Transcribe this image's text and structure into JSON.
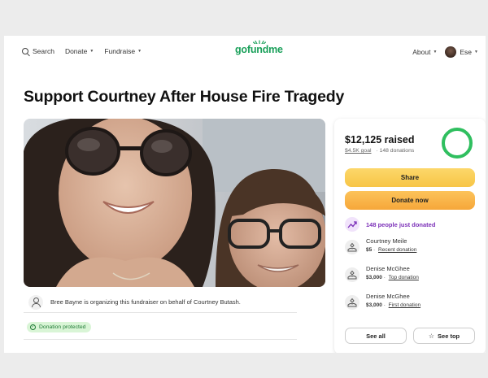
{
  "nav": {
    "search_label": "Search",
    "donate_label": "Donate",
    "fundraise_label": "Fundraise",
    "logo_text": "gofundme",
    "about_label": "About",
    "user_name": "Ese"
  },
  "campaign": {
    "title": "Support Courtney After House Fire Tragedy",
    "organizer_text": "Bree Bayne is organizing this fundraiser on behalf of Courtney Butash.",
    "protected_label": "Donation protected"
  },
  "donation": {
    "raised": "$12,125 raised",
    "goal": "$4.5K goal",
    "donations_count": "148 donations",
    "progress_fraction": 1.0,
    "share_label": "Share",
    "donate_now_label": "Donate now",
    "trend_text": "148 people just donated",
    "donors": [
      {
        "name": "Courtney Meile",
        "amount": "$5",
        "tag": "Recent donation"
      },
      {
        "name": "Denise McGhee",
        "amount": "$3,000",
        "tag": "Top donation"
      },
      {
        "name": "Denise McGhee",
        "amount": "$3,000",
        "tag": "First donation"
      }
    ],
    "see_all_label": "See all",
    "see_top_label": "See top"
  },
  "colors": {
    "brand_green": "#1aa05a",
    "share_yellow": "#f7c546",
    "donate_orange": "#f6a73a",
    "trend_purple": "#7b2fb8",
    "progress_green": "#2fbf5f"
  }
}
